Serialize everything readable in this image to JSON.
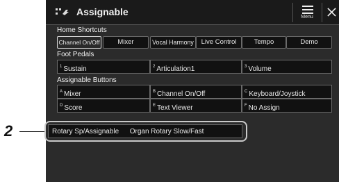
{
  "window": {
    "title": "Assignable",
    "menu_label": "Menu",
    "close_label": "✕"
  },
  "home_shortcuts": {
    "label": "Home Shortcuts",
    "items": [
      "Channel On/Off",
      "Mixer",
      "Vocal Harmony",
      "Live Control",
      "Tempo",
      "Demo"
    ],
    "selected_index": 0
  },
  "foot_pedals": {
    "label": "Foot Pedals",
    "items": [
      {
        "num": "1",
        "value": "Sustain"
      },
      {
        "num": "2",
        "value": "Articulation1"
      },
      {
        "num": "3",
        "value": "Volume"
      }
    ]
  },
  "assignable_buttons": {
    "label": "Assignable Buttons",
    "items": [
      {
        "letter": "A",
        "value": "Mixer"
      },
      {
        "letter": "B",
        "value": "Channel On/Off"
      },
      {
        "letter": "C",
        "value": "Keyboard/Joystick"
      },
      {
        "letter": "D",
        "value": "Score"
      },
      {
        "letter": "E",
        "value": "Text Viewer"
      },
      {
        "letter": "F",
        "value": "No Assign"
      }
    ]
  },
  "rotary": {
    "label": "Rotary Sp/Assignable",
    "value": "Organ Rotary Slow/Fast"
  },
  "callout": {
    "number": "2"
  }
}
